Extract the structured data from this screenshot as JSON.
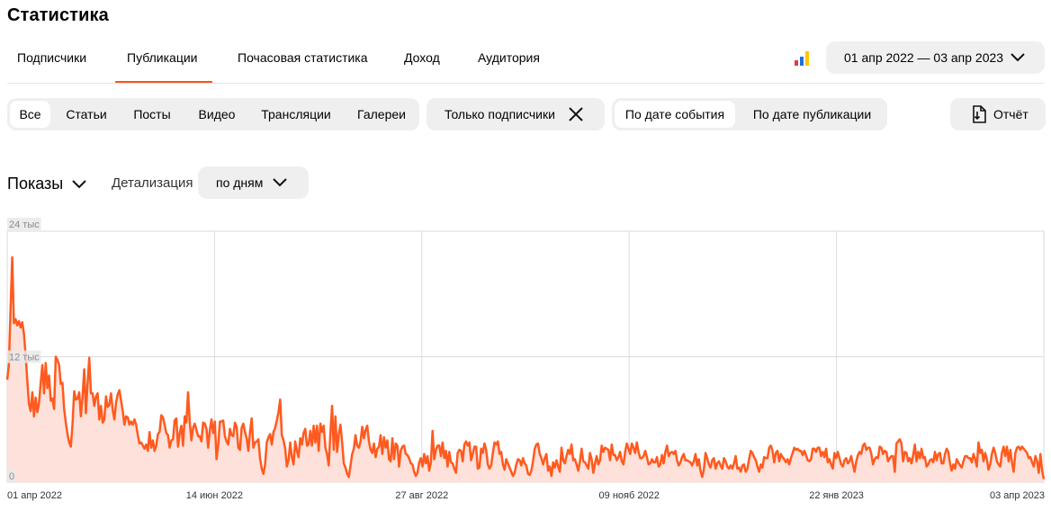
{
  "page": {
    "title": "Статистика"
  },
  "tabs": [
    {
      "label": "Подписчики",
      "active": false
    },
    {
      "label": "Публикации",
      "active": true
    },
    {
      "label": "Почасовая статистика",
      "active": false
    },
    {
      "label": "Доход",
      "active": false
    },
    {
      "label": "Аудитория",
      "active": false
    }
  ],
  "date_range": {
    "label": "01 апр 2022 — 03 апр 2023",
    "icon": "chevron-down-icon"
  },
  "content_filter": {
    "items": [
      {
        "label": "Все",
        "active": true
      },
      {
        "label": "Статьи",
        "active": false
      },
      {
        "label": "Посты",
        "active": false
      },
      {
        "label": "Видео",
        "active": false
      },
      {
        "label": "Трансляции",
        "active": false
      },
      {
        "label": "Галереи",
        "active": false
      }
    ]
  },
  "subscribers_filter": {
    "label": "Только подписчики",
    "icon": "close-icon"
  },
  "date_mode": {
    "items": [
      {
        "label": "По дате события",
        "active": true
      },
      {
        "label": "По дате публикации",
        "active": false
      }
    ]
  },
  "report_button": {
    "label": "Отчёт",
    "icon": "export-file-icon"
  },
  "metric_selector": {
    "label": "Показы",
    "icon": "chevron-down-icon"
  },
  "detail": {
    "label": "Детализация",
    "value": "по дням"
  },
  "colors": {
    "accent": "#ff4f12",
    "line": "#ff5a1f",
    "fill": "#fde1da",
    "pill_bg": "#efefef"
  },
  "chart_data": {
    "type": "area",
    "y_tick_labels": [
      "24 тыс",
      "12 тыс",
      "0"
    ],
    "y_ticks": [
      24000,
      12000,
      0
    ],
    "ylim": [
      0,
      24000
    ],
    "x_tick_labels": [
      "01 апр 2022",
      "14 июн 2022",
      "27 авг 2022",
      "09 нояб 2022",
      "22 янв 2023",
      "03 апр 2023"
    ],
    "x_range": [
      "2022-04-01",
      "2023-04-03"
    ],
    "grid": true,
    "series": [
      {
        "values": [
          9800,
          11200,
          16500,
          21500,
          15200,
          15600,
          15000,
          15400,
          14800,
          15300,
          14200,
          12200,
          9700,
          7500,
          6800,
          8600,
          6300,
          8100,
          6700,
          7600,
          9500,
          11200,
          8500,
          11400,
          9000,
          10200,
          7800,
          8000,
          7000,
          12000,
          11700,
          11200,
          9400,
          9500,
          7000,
          5700,
          4600,
          3800,
          3400,
          5500,
          8700,
          7900,
          8000,
          8600,
          6300,
          8200,
          10800,
          6600,
          9400,
          11900,
          8500,
          8500,
          7300,
          8200,
          8500,
          6000,
          7300,
          5700,
          6000,
          8200,
          7200,
          7400,
          8500,
          6900,
          6000,
          7600,
          8400,
          8800,
          7800,
          6800,
          5500,
          6300,
          6200,
          5500,
          5800,
          5500,
          6000,
          5500,
          4500,
          3700,
          3800,
          3500,
          3200,
          3600,
          3000,
          4800,
          3300,
          4000,
          3000,
          3500,
          4600,
          4800,
          6400,
          6200,
          5500,
          4700,
          4500,
          3300,
          4000,
          4100,
          5900,
          6100,
          3400,
          4700,
          5400,
          3500,
          6300,
          5700,
          8600,
          5800,
          4000,
          5200,
          5600,
          5000,
          4400,
          4400,
          3900,
          5700,
          5600,
          5100,
          3300,
          5000,
          6000,
          4700,
          5800,
          2200,
          3500,
          5800,
          5800,
          5900,
          4400,
          3900,
          3600,
          5100,
          4500,
          4400,
          5700,
          5300,
          3300,
          3100,
          5200,
          5600,
          4800,
          4200,
          3000,
          4800,
          6100,
          3300,
          3800,
          3900,
          4100,
          2300,
          1300,
          800,
          1700,
          3800,
          4300,
          4600,
          3600,
          4800,
          5200,
          5900,
          6700,
          7900,
          4500,
          4000,
          3200,
          1500,
          2100,
          3800,
          2400,
          1700,
          3900,
          3000,
          2400,
          4200,
          3600,
          4700,
          5100,
          3500,
          3600,
          4900,
          3500,
          5400,
          3800,
          5400,
          3000,
          5600,
          4800,
          5400,
          3300,
          2700,
          1600,
          4700,
          7300,
          3100,
          6300,
          2900,
          4600,
          5500,
          3800,
          1800,
          1400,
          800,
          500,
          1600,
          2700,
          3200,
          4500,
          3500,
          3300,
          3900,
          5300,
          4200,
          5000,
          5400,
          3900,
          3100,
          2800,
          3700,
          2400,
          3200,
          3400,
          4500,
          2700,
          4300,
          3300,
          4000,
          2200,
          2000,
          4200,
          2200,
          3700,
          3500,
          1500,
          3000,
          3400,
          3500,
          2700,
          2600,
          2300,
          1800,
          1700,
          1000,
          600,
          900,
          1900,
          2300,
          1500,
          2700,
          1800,
          2500,
          1100,
          1900,
          4900,
          2200,
          3100,
          3500,
          3500,
          2500,
          3800,
          2300,
          3000,
          1500,
          2900,
          1900,
          1800,
          1300,
          900,
          2800,
          3100,
          3000,
          2000,
          3600,
          3900,
          3500,
          3800,
          2100,
          2700,
          3400,
          3400,
          1300,
          1400,
          3200,
          2800,
          3700,
          3100,
          1700,
          1300,
          1600,
          2800,
          3800,
          3600,
          3900,
          2700,
          2900,
          1700,
          1200,
          2200,
          1800,
          1400,
          1000,
          600,
          900,
          1700,
          2200,
          2100,
          1600,
          2300,
          1800,
          1600,
          800,
          700,
          1100,
          2000,
          3200,
          3600,
          3700,
          2700,
          2300,
          1700,
          2300,
          2700,
          1100,
          1500,
          600,
          1900,
          1400,
          2100,
          1500,
          1000,
          3300,
          2100,
          1800,
          2500,
          3100,
          2700,
          3600,
          2100,
          2200,
          1700,
          1100,
          2000,
          3200,
          2000,
          1900,
          1600,
          1300,
          2800,
          2200,
          900,
          1800,
          2500,
          1700,
          2100,
          3500,
          2900,
          3300,
          3200,
          3100,
          2100,
          3600,
          2600,
          2600,
          2100,
          2400,
          2900,
          2000,
          1700,
          2900,
          3700,
          3200,
          2700,
          3700,
          3300,
          2800,
          3800,
          2900,
          2300,
          2300,
          2500,
          3000,
          2400,
          1700,
          1800,
          2200,
          1900,
          1900,
          2400,
          1500,
          1700,
          2600,
          1800,
          2900,
          3500,
          2500,
          2800,
          2900,
          2700,
          3000,
          2100,
          1600,
          1900,
          2400,
          2700,
          2100,
          2100,
          2000,
          1900,
          1600,
          2000,
          2700,
          1600,
          2200,
          1100,
          500,
          1200,
          2800,
          2300,
          1700,
          1400,
          2100,
          2300,
          1300,
          1800,
          2000,
          1600,
          1300,
          2300,
          2000,
          1500,
          1300,
          1600,
          1300,
          1800,
          2500,
          1300,
          1400,
          1000,
          1600,
          1700,
          1000,
          1300,
          2200,
          3000,
          2800,
          2400,
          2100,
          1500,
          1000,
          1700,
          1400,
          2400,
          2300,
          2300,
          3300,
          3500,
          3000,
          1900,
          2800,
          3000,
          2000,
          2700,
          2400,
          2200,
          1900,
          2200,
          1700,
          2300,
          2800,
          3300,
          3100,
          3200,
          3000,
          3000,
          2600,
          3000,
          2600,
          2100,
          2000,
          2200,
          3200,
          3200,
          2900,
          3300,
          3300,
          2500,
          2900,
          2400,
          3200,
          1900,
          2200,
          1700,
          1300,
          2800,
          2300,
          2900,
          2300,
          1700,
          1500,
          2100,
          2300,
          1800,
          2000,
          2500,
          1700,
          1000,
          2000,
          2600,
          2900,
          2700,
          3500,
          3700,
          3100,
          3300,
          3300,
          2700,
          1700,
          2200,
          2400,
          2300,
          3400,
          3300,
          2700,
          3000,
          2900,
          2000,
          2300,
          2500,
          2500,
          1000,
          3700,
          3900,
          4100,
          3700,
          2000,
          2900,
          2800,
          2000,
          2300,
          1800,
          2600,
          3600,
          2000,
          2900,
          2300,
          3200,
          2300,
          2400,
          1500,
          1700,
          2100,
          2200,
          1900,
          2900,
          2100,
          2700,
          2800,
          1800,
          1800,
          2700,
          3200,
          2900,
          1800,
          1100,
          1700,
          1300,
          2200,
          1900,
          1600,
          1400,
          2000,
          2500,
          2500,
          2300,
          2300,
          1900,
          2700,
          2200,
          1500,
          3800,
          2800,
          3100,
          2000,
          2800,
          2200,
          1200,
          1700,
          2700,
          3300,
          2800,
          2000,
          1700,
          1500,
          2800,
          3400,
          2500,
          3400,
          2000,
          3100,
          1900,
          1000,
          2800,
          3300,
          3400,
          3100,
          3400,
          3200,
          3000,
          2800,
          2300,
          2400,
          1900,
          1500,
          2500,
          2000,
          900,
          2700,
          1100,
          300
        ]
      }
    ]
  }
}
